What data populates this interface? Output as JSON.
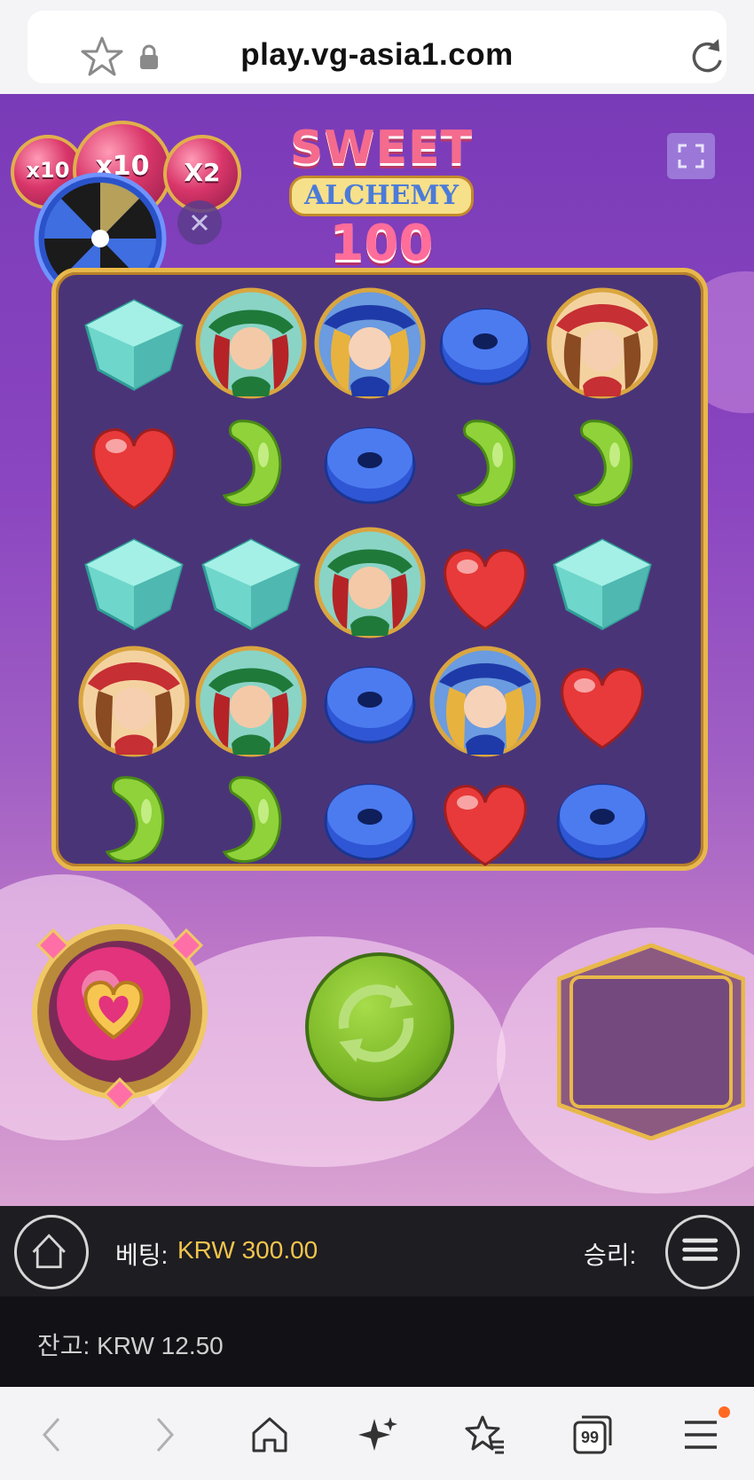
{
  "browser": {
    "url": "play.vg-asia1.com",
    "icons": [
      "star-icon",
      "lock-icon",
      "reload-icon"
    ]
  },
  "game": {
    "title_line1": "SWEET",
    "title_line2": "ALCHEMY",
    "title_line3": "100",
    "multipliers": [
      "x10",
      "x10",
      "X2"
    ],
    "reels": [
      [
        "cube",
        "witch-red",
        "witch-blonde",
        "donut",
        "witch-brown"
      ],
      [
        "heart",
        "bean",
        "donut",
        "bean",
        "bean"
      ],
      [
        "cube",
        "cube",
        "witch-red",
        "heart",
        "cube"
      ],
      [
        "witch-brown",
        "witch-red",
        "donut",
        "witch-blonde",
        "heart"
      ],
      [
        "bean",
        "bean",
        "donut",
        "heart",
        "donut"
      ]
    ],
    "colors": {
      "accent": "#e8b84a",
      "spin": "#79b525",
      "bet_value": "#f3c44c"
    }
  },
  "status": {
    "bet_label": "베팅:",
    "bet_value": "KRW 300.00",
    "win_label": "승리:",
    "balance": "잔고: KRW 12.50"
  },
  "nav": {
    "items": [
      "back-icon",
      "forward-icon",
      "home-icon",
      "sparkle-icon",
      "bookmarks-icon",
      "tabs-icon",
      "menu-icon"
    ],
    "tabs_count": "99"
  }
}
